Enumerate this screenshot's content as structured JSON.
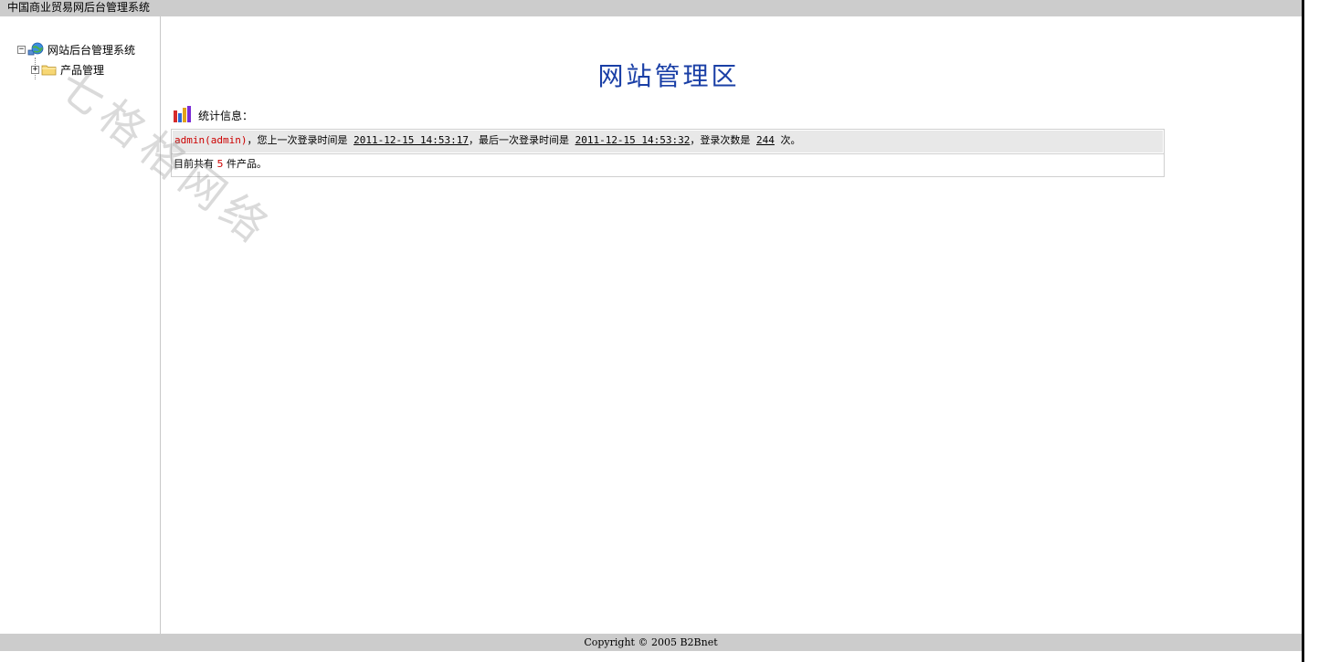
{
  "window": {
    "title": "中国商业贸易网后台管理系统"
  },
  "sidebar": {
    "tree": {
      "root_label": "网站后台管理系统",
      "root_toggle": "−",
      "children": [
        {
          "label": "产品管理",
          "toggle": "+"
        }
      ]
    }
  },
  "main": {
    "title": "网站管理区",
    "stats": {
      "header_label": "统计信息：",
      "user": "admin(admin)",
      "text_prev_login": "，您上一次登录时间是",
      "prev_login_time": "2011-12-15 14:53:17",
      "text_last_login": "，最后一次登录时间是",
      "last_login_time": "2011-12-15 14:53:32",
      "text_login_count": "，登录次数是",
      "login_count": "244",
      "text_count_suffix": "次。",
      "text_products_prefix": "目前共有",
      "product_count": "5",
      "text_products_suffix": "件产品。"
    }
  },
  "footer": {
    "copyright": "Copyright © 2005 B2Bnet"
  },
  "watermark": {
    "text": "七格格网络"
  },
  "colors": {
    "title_blue": "#1a3fa6",
    "highlight_red": "#cc0000",
    "bar_gray": "#cccccc"
  }
}
